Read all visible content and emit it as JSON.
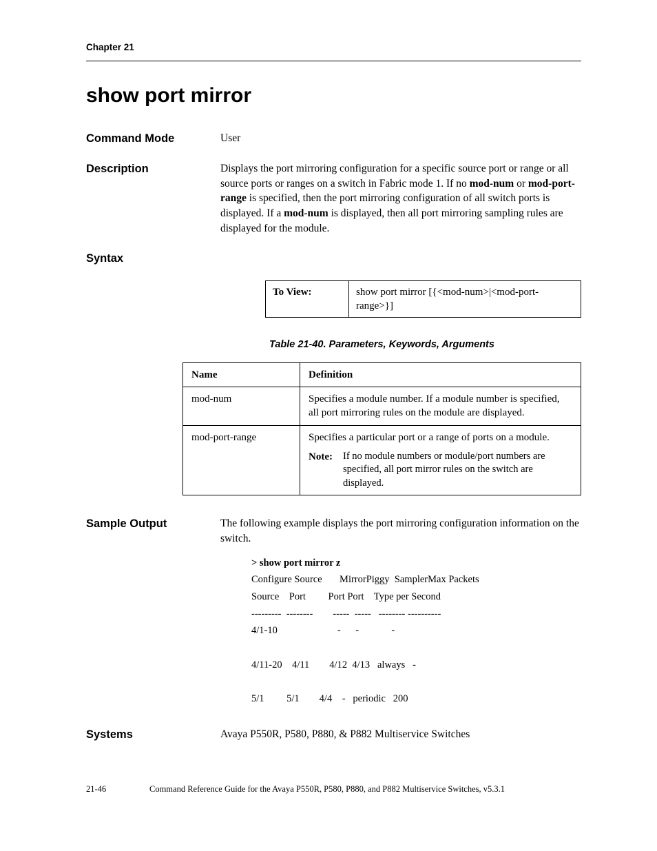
{
  "header": {
    "chapter": "Chapter 21"
  },
  "title": "show port mirror",
  "sections": {
    "command_mode": {
      "label": "Command Mode",
      "value": "User"
    },
    "description": {
      "label": "Description",
      "text_before": "Displays the port mirroring configuration for a specific source port or range or all source ports or ranges on a switch in Fabric mode 1. If no ",
      "bold1": "mod-num",
      "mid1": " or ",
      "bold2": "mod-port-range",
      "mid2": " is specified, then the port mirroring configuration of all switch ports is displayed. If a ",
      "bold3": "mod-num",
      "text_after": " is displayed, then all port mirroring sampling rules are displayed for the module."
    },
    "syntax": {
      "label": "Syntax",
      "to_view_label": "To View:",
      "to_view_value": "show port mirror [{<mod-num>|<mod-port-range>}]"
    },
    "table_caption": "Table 21-40.  Parameters, Keywords, Arguments",
    "param_headers": {
      "name": "Name",
      "definition": "Definition"
    },
    "params": [
      {
        "name": "mod-num",
        "definition": "Specifies a module number. If a module number is specified, all port mirroring rules on the module are displayed."
      },
      {
        "name": "mod-port-range",
        "definition": "Specifies a particular port or a range of ports on a module.",
        "note_label": "Note:",
        "note": "If no module numbers or module/port numbers are specified, all port mirror rules on the switch are displayed."
      }
    ],
    "sample_output": {
      "label": "Sample Output",
      "intro": "The following example displays the port mirroring configuration information on the switch.",
      "cmd": "> show port mirror z",
      "hdr1": "Configure Source       MirrorPiggy  SamplerMax Packets",
      "hdr2": "Source    Port         Port Port    Type per Second",
      "sep": "---------  --------        -----  -----   -------- ----------",
      "row1": "4/1-10                        -      -             -",
      "row2": "4/11-20    4/11        4/12  4/13   always   -",
      "row3": "5/1         5/1        4/4    -   periodic   200"
    },
    "systems": {
      "label": "Systems",
      "value": "Avaya P550R, P580, P880, & P882 Multiservice Switches"
    }
  },
  "footer": {
    "pagenum": "21-46",
    "guide": "Command Reference Guide for the Avaya P550R, P580, P880, and P882 Multiservice Switches, v5.3.1"
  }
}
